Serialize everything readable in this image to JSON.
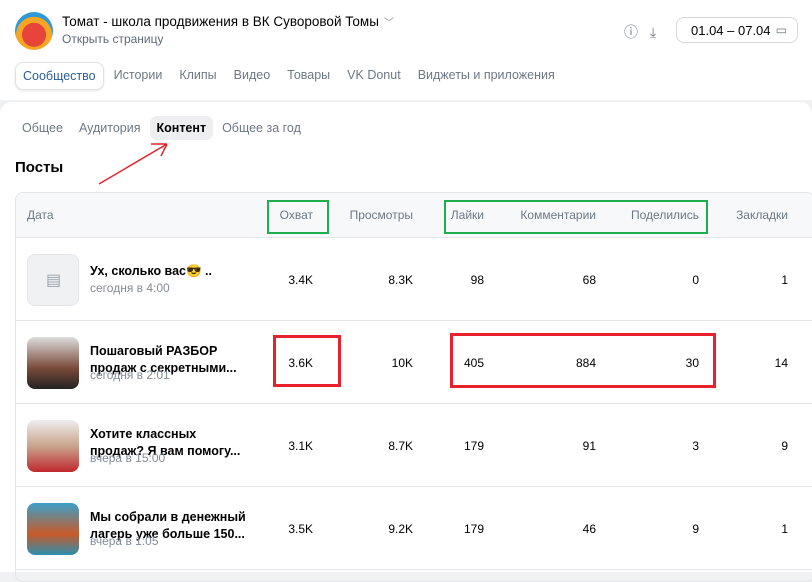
{
  "header": {
    "community_name": "Томат - школа продвижения в ВК Суворовой Томы",
    "open_page": "Открыть страницу",
    "date_range": "01.04 – 07.04"
  },
  "tabs": [
    "Сообщество",
    "Истории",
    "Клипы",
    "Видео",
    "Товары",
    "VK Donut",
    "Виджеты и приложения"
  ],
  "subtabs": [
    "Общее",
    "Аудитория",
    "Контент",
    "Общее за год"
  ],
  "section_title": "Посты",
  "columns": [
    "Дата",
    "Охват",
    "Просмотры",
    "Лайки",
    "Комментарии",
    "Поделились",
    "Закладки"
  ],
  "posts": [
    {
      "title": "Ух, сколько вас😎 ..",
      "date": "сегодня в 4:00",
      "reach": "3.4K",
      "views": "8.3K",
      "likes": "98",
      "comments": "68",
      "shares": "0",
      "bookmarks": "1"
    },
    {
      "title": "Пошаговый РАЗБОР продаж с секретными...",
      "date": "сегодня в 2:01",
      "reach": "3.6K",
      "views": "10K",
      "likes": "405",
      "comments": "884",
      "shares": "30",
      "bookmarks": "14"
    },
    {
      "title": "Хотите классных продаж?  Я вам помогу...",
      "date": "вчера в 15:00",
      "reach": "3.1K",
      "views": "8.7K",
      "likes": "179",
      "comments": "91",
      "shares": "3",
      "bookmarks": "9"
    },
    {
      "title": "Мы собрали в денежный лагерь уже больше 150...",
      "date": "вчера в 1:05",
      "reach": "3.5K",
      "views": "9.2K",
      "likes": "179",
      "comments": "46",
      "shares": "9",
      "bookmarks": "1"
    }
  ]
}
